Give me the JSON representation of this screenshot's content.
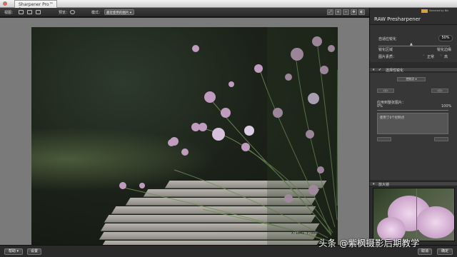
{
  "window": {
    "title": "Sharpener Pro™ 3"
  },
  "toolbar": {
    "view_label": "视图：",
    "split_label": "预览：",
    "mode_label": "模式：",
    "mode_value": "最近使用的图片 ▾"
  },
  "canvas": {
    "coordinate_readout": "X:1841 Y:0000"
  },
  "bottombar": {
    "help_label": "帮助 ▾",
    "settings_label": "设置",
    "cancel_label": "取消",
    "ok_label": "确定"
  },
  "watermark": "头条 @紫枫摄影后期教学",
  "panel": {
    "title": "RAW Presharpener",
    "logo_text": "Selected by Nik",
    "adaptive_label": "自适应锐化",
    "adaptive_value": "50%",
    "sharpen_areas_label": "锐化区域",
    "sharpen_edges_label": "锐化边缘",
    "image_quality_label": "图片素质：",
    "quality_options": [
      "正常",
      "高"
    ],
    "selective_section_label": "选择性锐化",
    "control_point_label": "控制点 ▾",
    "apply_to_image_label": "应用到整张图片：",
    "range_min": "0%",
    "range_max": "100%",
    "control_points_text": "使用了0个控制点",
    "preview_section_label": "放大镜"
  },
  "colors": {
    "panel_bg": "#2b2b2b",
    "canvas_bg": "#7a7a7a",
    "accent_logo": "#d6a13a"
  }
}
